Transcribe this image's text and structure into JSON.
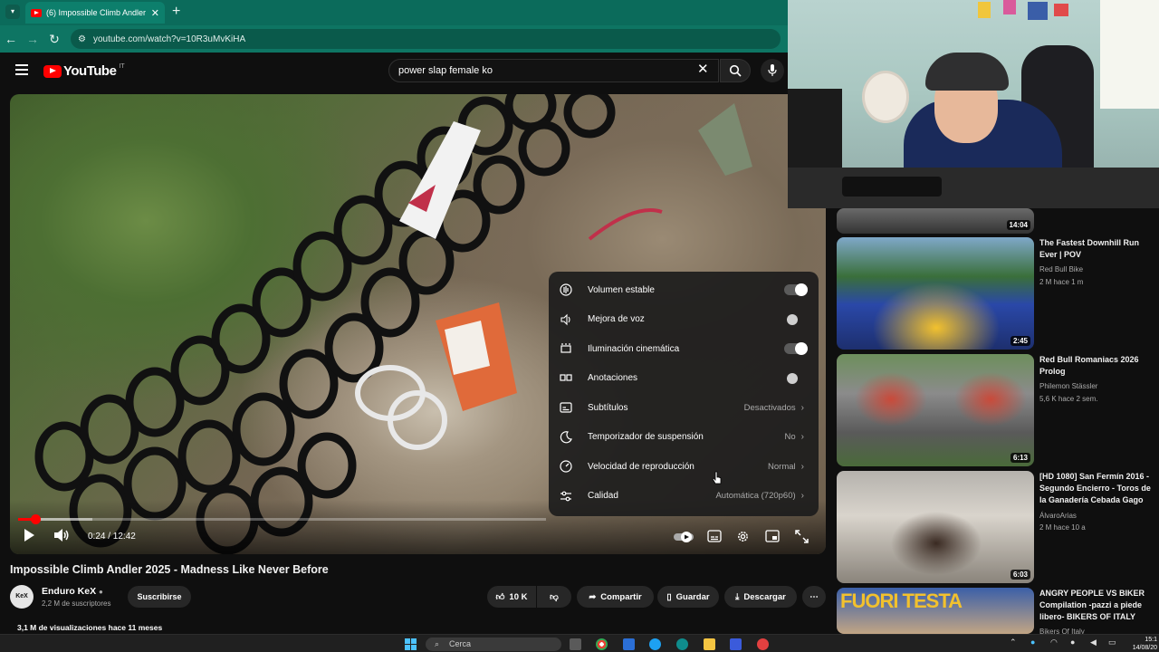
{
  "browser": {
    "tab_title": "(6) Impossible Climb Andler 20...",
    "url": "youtube.com/watch?v=10R3uMvKiHA"
  },
  "youtube": {
    "logo_text": "YouTube",
    "country": "IT",
    "search_value": "power slap female ko"
  },
  "player": {
    "time_current": "0:24",
    "time_total": "12:42",
    "time_display": "0:24 / 12:42",
    "progress_fraction": 0.032,
    "buffered_fraction": 0.14
  },
  "settings_menu": {
    "items": [
      {
        "label": "Volumen estable",
        "icon": "stable-volume-icon",
        "type": "toggle",
        "on": true
      },
      {
        "label": "Mejora de voz",
        "icon": "voice-boost-icon",
        "type": "toggle",
        "on": false
      },
      {
        "label": "Iluminación cinemática",
        "icon": "ambient-mode-icon",
        "type": "toggle",
        "on": true
      },
      {
        "label": "Anotaciones",
        "icon": "annotations-icon",
        "type": "toggle",
        "on": false
      },
      {
        "label": "Subtítulos",
        "icon": "subtitles-icon",
        "type": "value",
        "value": "Desactivados"
      },
      {
        "label": "Temporizador de suspensión",
        "icon": "sleep-timer-icon",
        "type": "value",
        "value": "No"
      },
      {
        "label": "Velocidad de reproducción",
        "icon": "playback-speed-icon",
        "type": "value",
        "value": "Normal"
      },
      {
        "label": "Calidad",
        "icon": "quality-icon",
        "type": "value",
        "value": "Automática (720p60)"
      }
    ]
  },
  "video_info": {
    "title": "Impossible Climb Andler 2025 - Madness Like Never Before",
    "channel": "Enduro KeX",
    "avatar_text": "KeX",
    "subscribers": "2,2 M de suscriptores",
    "subscribe_label": "Suscribirse",
    "likes": "10 K",
    "share_label": "Compartir",
    "save_label": "Guardar",
    "download_label": "Descargar",
    "views_line": "3,1 M de visualizaciones hace 11 meses"
  },
  "recommendations": [
    {
      "duration": "14:04"
    },
    {
      "title": "The Fastest Downhill Run Ever | POV",
      "channel": "Red Bull Bike",
      "meta": "2 M  hace 1 m",
      "duration": "2:45"
    },
    {
      "title": "Red Bull Romaniacs 2026 Prolog",
      "channel": "Philemon Stässler",
      "meta": "5,6 K  hace 2 sem.",
      "duration": "6:13"
    },
    {
      "title": "[HD 1080] San Fermín 2016 - Segundo Encierro - Toros de la Ganadería Cebada Gago",
      "channel": "ÁlvaroArias",
      "meta": "2 M  hace 10 a",
      "duration": "6:03"
    },
    {
      "title": "ANGRY PEOPLE VS BIKER Compilation -pazzi a piede libero- BIKERS OF ITALY",
      "channel": "Bikers Of Italy",
      "thumb_text": "FUORI TESTA"
    }
  ],
  "taskbar": {
    "search_label": "Cerca",
    "time": "15:1",
    "date": "14/08/20"
  },
  "colors": {
    "youtube_red": "#ff0000",
    "browser_green": "#0b6b5b",
    "background": "#0f0f0f"
  }
}
